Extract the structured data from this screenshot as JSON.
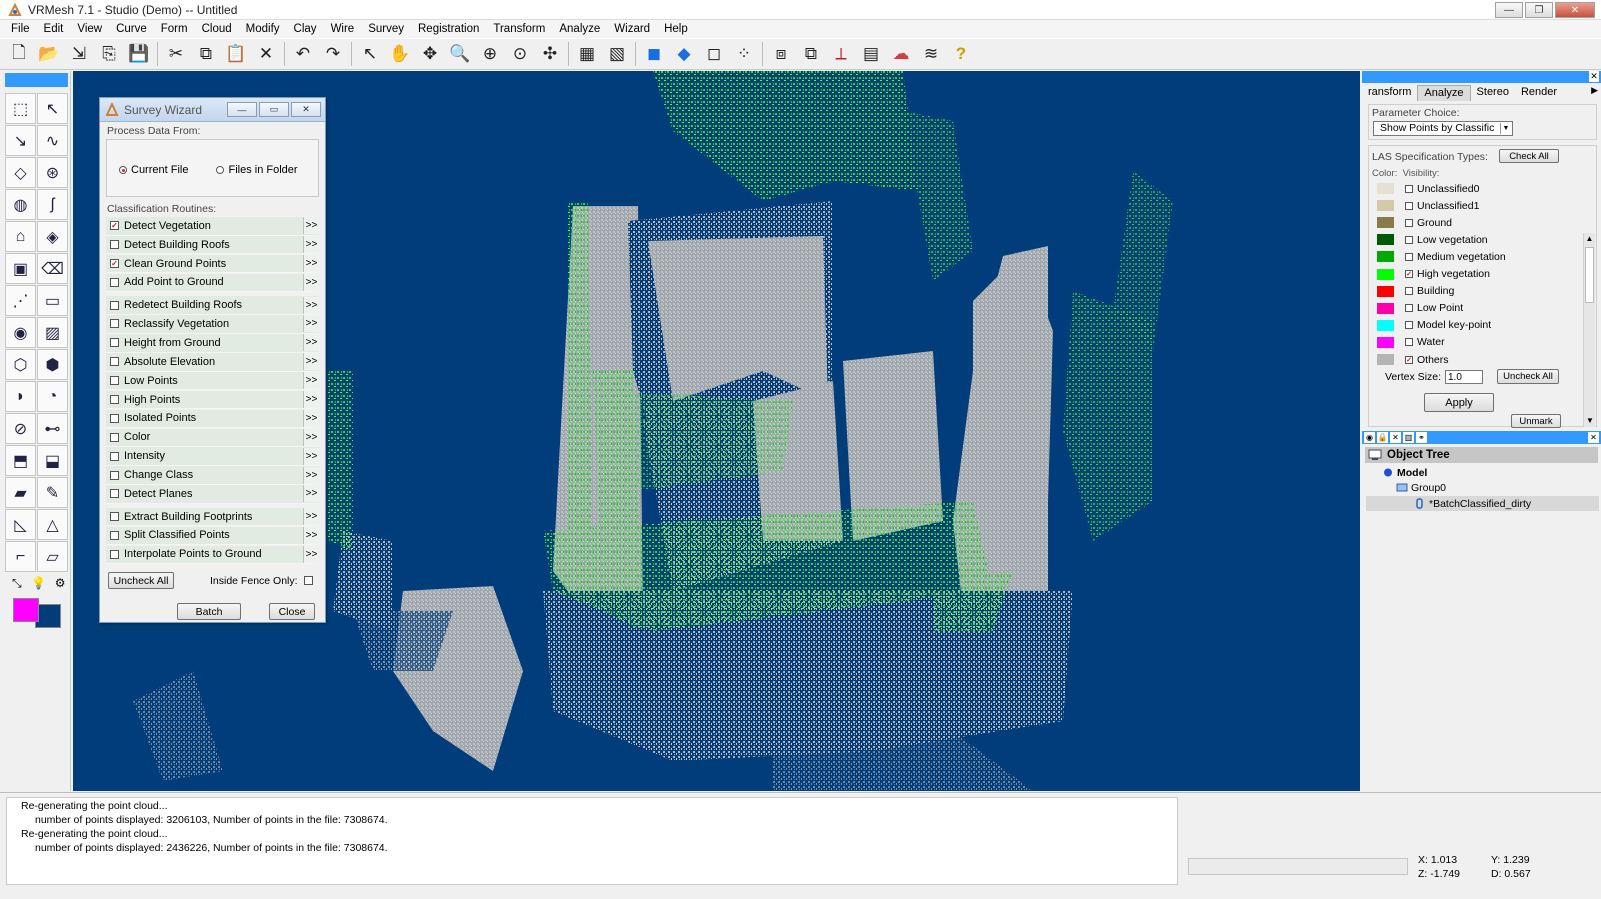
{
  "window": {
    "title": "VRMesh 7.1 - Studio (Demo) -- Untitled",
    "buttons": [
      "—",
      "❐",
      "✕"
    ]
  },
  "menu": [
    "File",
    "Edit",
    "View",
    "Curve",
    "Form",
    "Cloud",
    "Modify",
    "Clay",
    "Wire",
    "Survey",
    "Registration",
    "Transform",
    "Analyze",
    "Wizard",
    "Help"
  ],
  "toolbar": {
    "tools": [
      {
        "name": "new-file-icon",
        "glyph": "🗋"
      },
      {
        "name": "open-folder-icon",
        "glyph": "📂"
      },
      {
        "name": "import-icon",
        "glyph": "⇲"
      },
      {
        "name": "export-icon",
        "glyph": "⎘"
      },
      {
        "name": "save-icon",
        "glyph": "💾"
      },
      {
        "sep": true
      },
      {
        "name": "cut-icon",
        "glyph": "✂"
      },
      {
        "name": "copy-icon",
        "glyph": "⧉"
      },
      {
        "name": "paste-icon",
        "glyph": "📋"
      },
      {
        "name": "delete-icon",
        "glyph": "✕"
      },
      {
        "sep": true
      },
      {
        "name": "undo-icon",
        "glyph": "↶"
      },
      {
        "name": "redo-icon",
        "glyph": "↷"
      },
      {
        "sep": true
      },
      {
        "name": "select-icon",
        "glyph": "↖"
      },
      {
        "name": "pan-hand-icon",
        "glyph": "✋"
      },
      {
        "name": "rotate-icon",
        "glyph": "✥"
      },
      {
        "name": "zoom-icon",
        "glyph": "🔍"
      },
      {
        "name": "zoom-window-icon",
        "glyph": "⊕"
      },
      {
        "name": "zoom-fit-icon",
        "glyph": "⊙"
      },
      {
        "name": "move-view-icon",
        "glyph": "✣"
      },
      {
        "sep": true
      },
      {
        "name": "grid-icon",
        "glyph": "▦"
      },
      {
        "name": "grid-plane-icon",
        "glyph": "▧"
      },
      {
        "sep": true
      },
      {
        "name": "shaded-icon",
        "glyph": "◼"
      },
      {
        "name": "smooth-shaded-icon",
        "glyph": "◆"
      },
      {
        "name": "wireframe-icon",
        "glyph": "◻"
      },
      {
        "name": "points-view-icon",
        "glyph": "⁘"
      },
      {
        "sep": true
      },
      {
        "name": "view-front-icon",
        "glyph": "⧈"
      },
      {
        "name": "view-iso-icon",
        "glyph": "⧉"
      },
      {
        "name": "axis-icon",
        "glyph": "⟂"
      },
      {
        "name": "property-icon",
        "glyph": "▤"
      },
      {
        "name": "colors-icon",
        "glyph": "☁"
      },
      {
        "name": "analysis-icon",
        "glyph": "≋"
      },
      {
        "name": "help-icon",
        "glyph": "?"
      }
    ]
  },
  "left_palette": {
    "tools": [
      "cloud-view-icon",
      "select-points-icon",
      "curve-icon",
      "spline-icon",
      "plane-cut-icon",
      "sphere-fit-icon",
      "globe-icon",
      "smooth-curve-icon",
      "surface-edit-icon",
      "surface-fill-icon",
      "layer-icon",
      "eraser-icon",
      "scatter-icon",
      "ruler-icon",
      "earth-icon",
      "mesh-edit-icon",
      "mesh-repair-icon",
      "hexagon-icon",
      "clay-icon",
      "split-icon",
      "section-icon",
      "tube-icon",
      "box-icon",
      "extrude-icon",
      "color-map-icon",
      "paint-brush-icon",
      "triangle-icon",
      "measure-angle-icon",
      "fin-icon",
      "terrain-icon"
    ],
    "glyphs": [
      "⬚",
      "↖",
      "↘",
      "∿",
      "◇",
      "⊛",
      "◍",
      "ʃ",
      "⌂",
      "◈",
      "▣",
      "⌫",
      "⋰",
      "▭",
      "◉",
      "▨",
      "⬡",
      "⬢",
      "◗",
      "◔",
      "⊘",
      "⊷",
      "⬒",
      "⬓",
      "▰",
      "✎",
      "◺",
      "△",
      "⌐",
      "▱"
    ],
    "small_glyphs": [
      "⤡",
      "💡",
      "⚙"
    ],
    "fg_color": "#ff00ff",
    "bg_color": "#003d7a"
  },
  "wizard": {
    "title": "Survey Wizard",
    "process_label": "Process Data From:",
    "current_file": "Current File",
    "files_in_folder": "Files in Folder",
    "routines_label": "Classification Routines:",
    "routines": [
      {
        "label": "Detect Vegetation",
        "checked": true
      },
      {
        "label": "Detect Building Roofs",
        "checked": false
      },
      {
        "label": "Clean Ground Points",
        "checked": true
      },
      {
        "label": "Add Point to Ground",
        "checked": false
      },
      {
        "label": "Redetect Building Roofs",
        "checked": false
      },
      {
        "label": "Reclassify Vegetation",
        "checked": false
      },
      {
        "label": "Height from Ground",
        "checked": false
      },
      {
        "label": "Absolute Elevation",
        "checked": false
      },
      {
        "label": "Low Points",
        "checked": false
      },
      {
        "label": "High Points",
        "checked": false
      },
      {
        "label": "Isolated Points",
        "checked": false
      },
      {
        "label": "Color",
        "checked": false
      },
      {
        "label": "Intensity",
        "checked": false
      },
      {
        "label": "Change Class",
        "checked": false
      },
      {
        "label": "Detect Planes",
        "checked": false
      },
      {
        "label": "Extract Building Footprints",
        "checked": false
      },
      {
        "label": "Split Classified Points",
        "checked": false
      },
      {
        "label": "Interpolate Points to Ground",
        "checked": false
      }
    ],
    "more": ">>",
    "uncheck_all": "Uncheck All",
    "inside_fence": "Inside Fence Only:",
    "batch": "Batch",
    "close": "Close"
  },
  "right_panel": {
    "tabs": [
      "ransform",
      "Analyze",
      "Stereo",
      "Render"
    ],
    "param_label": "Parameter Choice:",
    "param_value": "Show Points by Classific",
    "las_label": "LAS Specification Types:",
    "check_all": "Check All",
    "color_label": "Color:",
    "visibility_label": "Visibility:",
    "classes": [
      {
        "name": "Unclassified0",
        "color": "#e6e0d0",
        "checked": false
      },
      {
        "name": "Unclassified1",
        "color": "#d4c9a8",
        "checked": false
      },
      {
        "name": "Ground",
        "color": "#8a7a48",
        "checked": false
      },
      {
        "name": "Low vegetation",
        "color": "#005a00",
        "checked": false
      },
      {
        "name": "Medium vegetation",
        "color": "#00aa00",
        "checked": false
      },
      {
        "name": "High vegetation",
        "color": "#00ff00",
        "checked": true
      },
      {
        "name": "Building",
        "color": "#ff0000",
        "checked": false
      },
      {
        "name": "Low Point",
        "color": "#ff00aa",
        "checked": false
      },
      {
        "name": "Model key-point",
        "color": "#00ffff",
        "checked": false
      },
      {
        "name": "Water",
        "color": "#ff00ff",
        "checked": false
      },
      {
        "name": "Others",
        "color": "#b4b4b4",
        "checked": true
      }
    ],
    "vertex_size_label": "Vertex Size:",
    "vertex_size": "1.0",
    "uncheck_all": "Uncheck All",
    "apply": "Apply",
    "unmark": "Unmark"
  },
  "object_tree": {
    "title": "Object Tree",
    "model": "Model",
    "group": "Group0",
    "item": "*BatchClassified_dirty"
  },
  "console": {
    "lines": [
      "Re-generating the point cloud...",
      "number of points displayed: 3206103, Number of points in the file: 7308674.",
      "Re-generating the point cloud...",
      "number of points displayed: 2436226, Number of points in the file: 7308674."
    ]
  },
  "status": {
    "x": "X: 1.013",
    "y": "Y: 1.239",
    "z": "Z: -1.749",
    "d": "D: 0.567"
  }
}
